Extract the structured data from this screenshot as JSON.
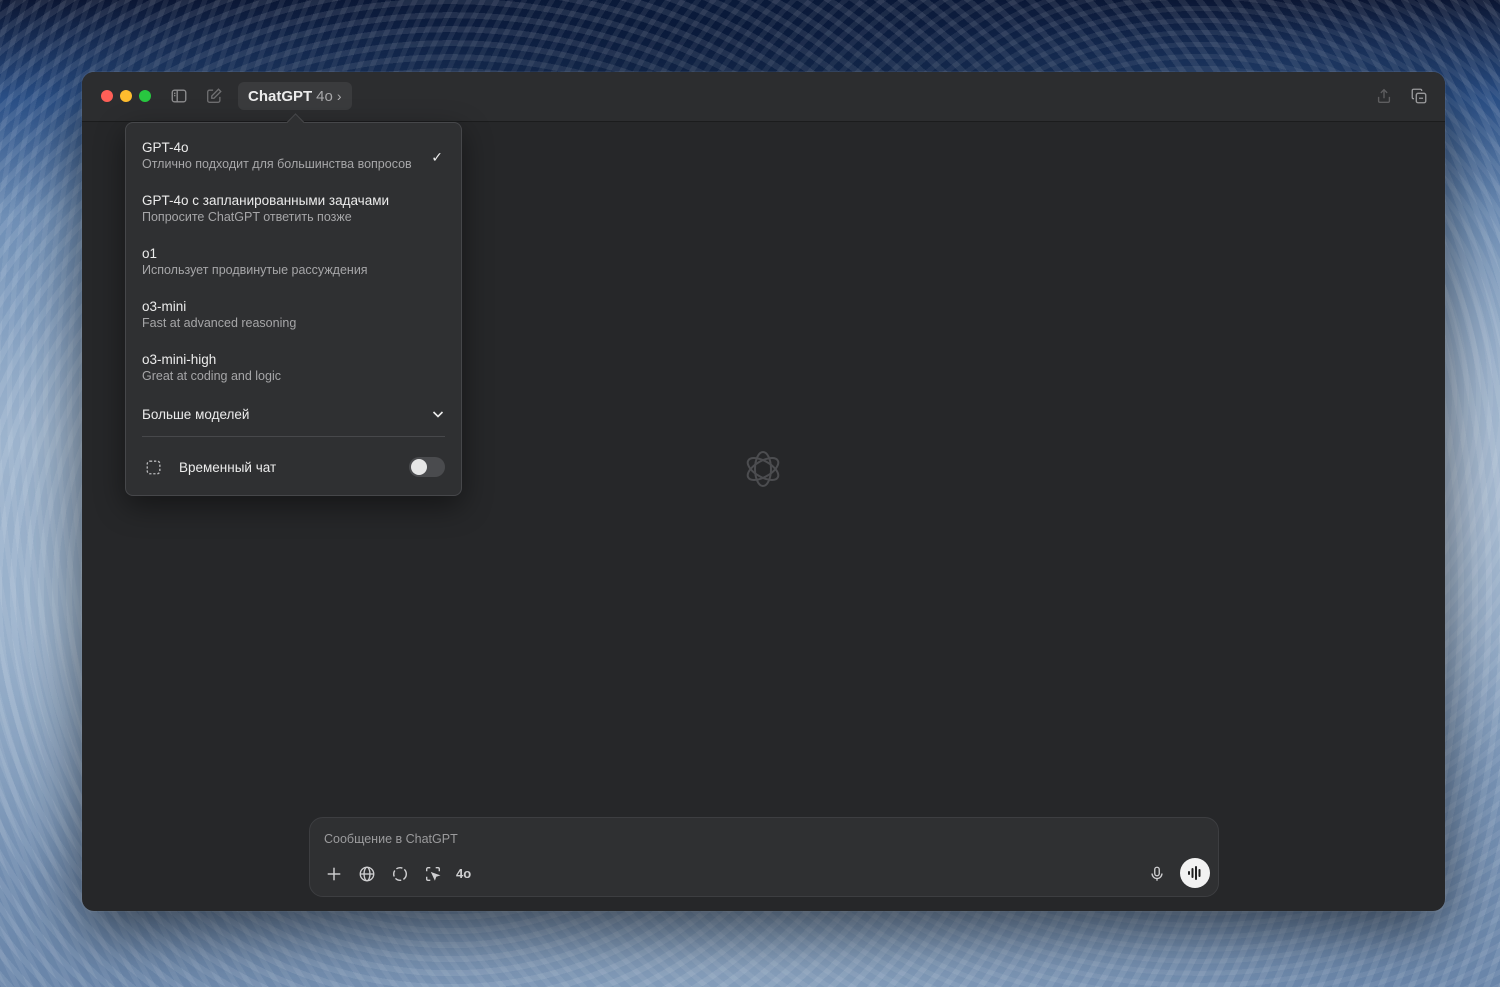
{
  "titlebar": {
    "app_name": "ChatGPT",
    "model_version": "4o",
    "chevron": "›"
  },
  "dropdown": {
    "options": [
      {
        "title": "GPT-4o",
        "desc": "Отлично подходит для большинства вопросов",
        "selected": true
      },
      {
        "title": "GPT-4o с запланированными задачами",
        "desc": "Попросите ChatGPT ответить позже",
        "selected": false
      },
      {
        "title": "o1",
        "desc": "Использует продвинутые рассуждения",
        "selected": false
      },
      {
        "title": "o3-mini",
        "desc": "Fast at advanced reasoning",
        "selected": false
      },
      {
        "title": "o3-mini-high",
        "desc": "Great at coding and logic",
        "selected": false
      }
    ],
    "check_mark": "✓",
    "more_models_label": "Больше моделей",
    "temporary_chat_label": "Временный чат",
    "temporary_chat_enabled": false
  },
  "composer": {
    "placeholder": "Сообщение в ChatGPT",
    "model_tag": "4o"
  },
  "icons": {
    "sidebar": "sidebar-toggle-icon",
    "new_chat": "compose-icon",
    "share": "share-icon",
    "new_window": "new-window-icon",
    "logo": "openai-logo-icon",
    "attach": "plus-icon",
    "search": "globe-icon",
    "reason": "circle-dashed-icon",
    "screen": "screen-select-icon",
    "mic": "microphone-icon",
    "voice": "voice-waveform-icon"
  },
  "colors": {
    "window_bg": "#262729",
    "titlebar_bg": "#2c2d2f",
    "dropdown_bg": "#2f3032",
    "text_primary": "#ececec",
    "text_secondary": "#a6a6a8"
  }
}
